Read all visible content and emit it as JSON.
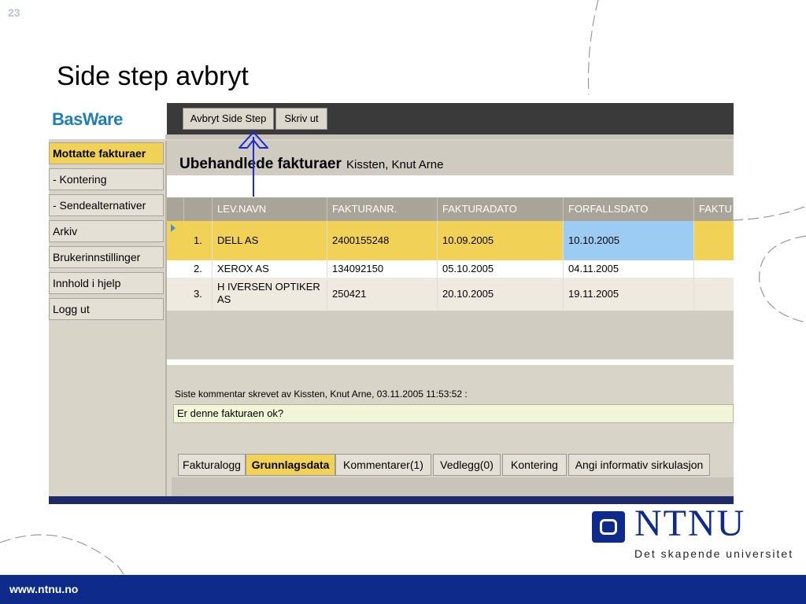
{
  "slide": {
    "number": "23",
    "title": "Side step avbryt"
  },
  "app": {
    "logo": "BasWare",
    "toolbar": {
      "cancel_side_step": "Avbryt Side Step",
      "print": "Skriv ut"
    },
    "sidebar": {
      "items": [
        {
          "label": "Mottatte fakturaer",
          "active": true
        },
        {
          "label": "- Kontering",
          "active": false
        },
        {
          "label": "- Sendealternativer",
          "active": false
        },
        {
          "label": "Arkiv",
          "active": false
        },
        {
          "label": "Brukerinnstillinger",
          "active": false
        },
        {
          "label": "Innhold i hjelp",
          "active": false
        },
        {
          "label": "Logg ut",
          "active": false
        }
      ]
    },
    "main": {
      "title": "Ubehandlede fakturaer",
      "user": "Kissten, Knut Arne",
      "columns": [
        "LEV.NAVN",
        "FAKTURANR.",
        "FAKTURADATO",
        "FORFALLSDATO",
        "FAKTU"
      ],
      "rows": [
        {
          "num": "1.",
          "supplier": "DELL AS",
          "invoice_no": "2400155248",
          "invoice_date": "10.09.2005",
          "due_date": "10.10.2005"
        },
        {
          "num": "2.",
          "supplier": "XEROX AS",
          "invoice_no": "134092150",
          "invoice_date": "05.10.2005",
          "due_date": "04.11.2005"
        },
        {
          "num": "3.",
          "supplier": "H IVERSEN OPTIKER AS",
          "invoice_no": "250421",
          "invoice_date": "20.10.2005",
          "due_date": "19.11.2005"
        }
      ],
      "comment_meta": "Siste kommentar skrevet av Kissten, Knut Arne, 03.11.2005 11:53:52 :",
      "comment_text": "Er denne fakturaen ok?",
      "tabs": [
        {
          "label": "Fakturalogg",
          "active": false
        },
        {
          "label": "Grunnlagsdata",
          "active": true
        },
        {
          "label": "Kommentarer(1)",
          "active": false
        },
        {
          "label": "Vedlegg(0)",
          "active": false
        },
        {
          "label": "Kontering",
          "active": false
        },
        {
          "label": "Angi informativ sirkulasjon",
          "active": false
        }
      ]
    }
  },
  "branding": {
    "name": "NTNU",
    "tagline": "Det skapende universitet",
    "url": "www.ntnu.no"
  },
  "colors": {
    "accent_yellow": "#f2d256",
    "selected_blue": "#9cccf4",
    "ntnu_blue": "#0e2a8a",
    "annotation_arrow": "#1a2ad8"
  }
}
